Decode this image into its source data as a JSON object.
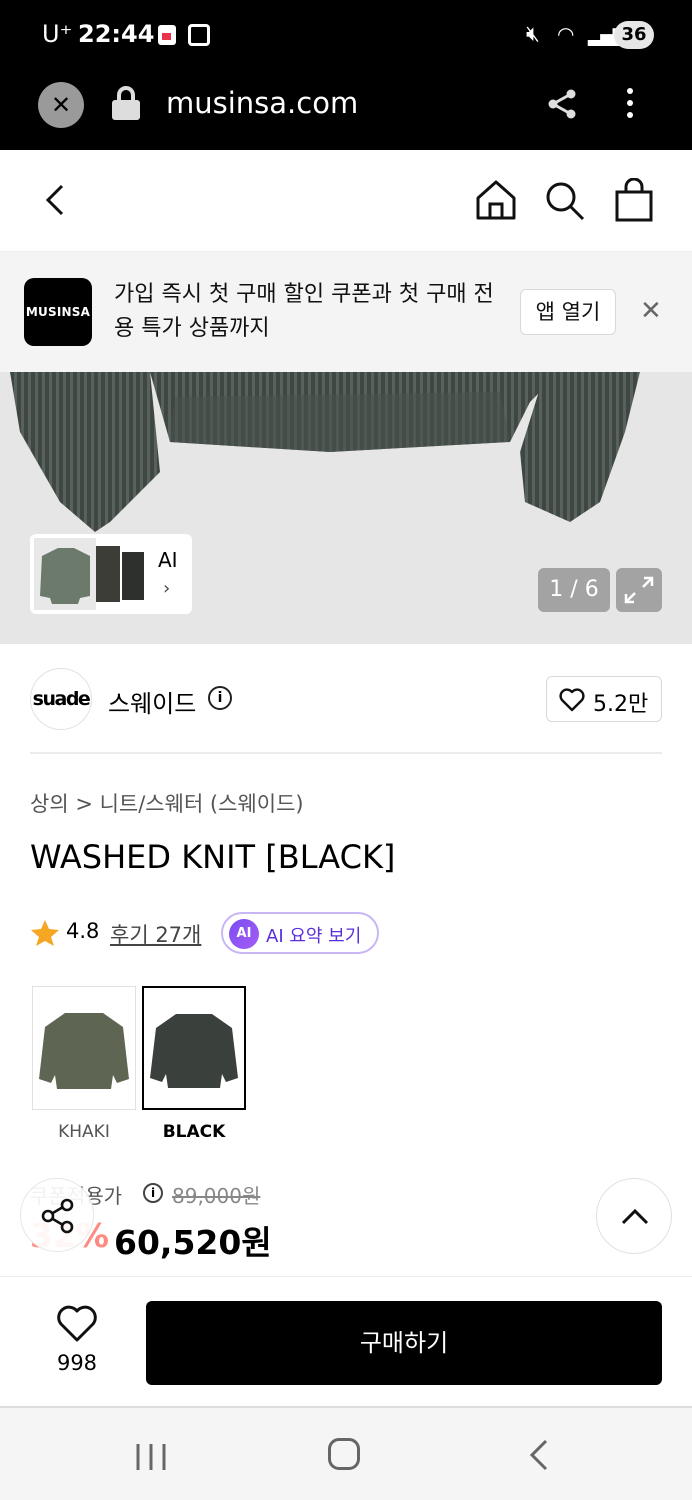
{
  "status_bar": {
    "carrier": "U⁺",
    "time": "22:44",
    "battery": "36"
  },
  "browser": {
    "url": "musinsa.com"
  },
  "promo": {
    "logo_text": "MUSINSA",
    "message": "가입 즉시 첫 구매 할인 쿠폰과 첫 구매 전용 특가 상품까지",
    "open_app_label": "앱 열기",
    "close_symbol": "✕"
  },
  "gallery": {
    "thumb_label": "AI",
    "thumb_chevron": "›",
    "counter": "1 / 6"
  },
  "brand": {
    "logo_text": "suade",
    "name": "스웨이드",
    "info_symbol": "i",
    "like_count": "5.2만"
  },
  "product": {
    "breadcrumb": "상의 > 니트/스웨터 (스웨이드)",
    "title": "WASHED KNIT [BLACK]",
    "rating": "4.8",
    "review_link": "후기 27개",
    "ai_badge": "AI",
    "ai_summary_label": "AI 요약 보기",
    "colors": [
      {
        "label": "KHAKI",
        "swatch": "#5f6553"
      },
      {
        "label": "BLACK",
        "swatch": "#3a403c",
        "selected": true
      }
    ]
  },
  "price": {
    "label": "쿠폰적용가",
    "info_symbol": "i",
    "original": "89,000원",
    "discount": "32%",
    "sale": "60,520원"
  },
  "action_bar": {
    "wish_count": "998",
    "buy_label": "구매하기"
  },
  "colors": {
    "accent_purple": "#5a2fd8",
    "discount_red": "#ff3d2e",
    "star": "#f5a623"
  }
}
